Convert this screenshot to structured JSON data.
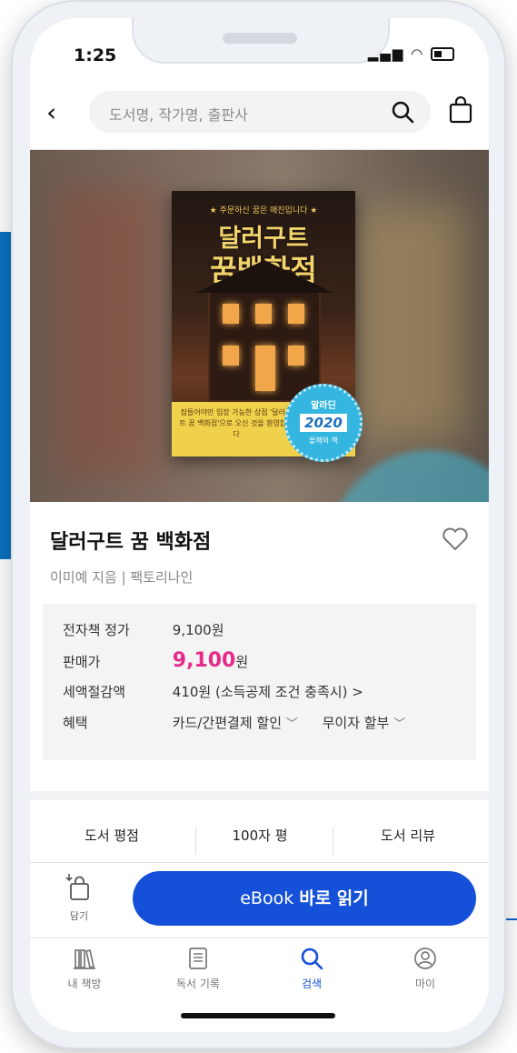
{
  "status": {
    "time": "1:25"
  },
  "search": {
    "placeholder": "도서명, 작가명, 출판사"
  },
  "cover": {
    "tagline": "★ 주문하신 꿈은 매진입니다 ★",
    "title_line1": "달러구트",
    "title_line2": "꿈백화점",
    "band_text": "잠들어야만 입장 가능한 상점\n'달러구트 꿈 백화점'으로\n오신 것을 환영합니다",
    "badge_top": "알라딘",
    "badge_year": "2020",
    "badge_bottom": "올해의 책"
  },
  "book": {
    "title": "달러구트 꿈 백화점",
    "author_line": "이미예 지음 | 팩토리나인"
  },
  "price": {
    "ebook_label": "전자책 정가",
    "ebook_value": "9,100원",
    "sale_label": "판매가",
    "sale_value": "9,100",
    "sale_unit": "원",
    "tax_label": "세액절감액",
    "tax_value": "410원 (소득공제 조건 충족시) >",
    "benefit_label": "혜택",
    "benefit_card": "카드/간편결제 할인",
    "benefit_installment": "무이자 할부"
  },
  "tabs": [
    "도서 평점",
    "100자 평",
    "도서 리뷰"
  ],
  "actions": {
    "cart_label": "담기",
    "read_prefix": "eBook ",
    "read_bold": "바로 읽기"
  },
  "nav": [
    {
      "label": "내 책방",
      "icon": "library-icon"
    },
    {
      "label": "독서 기록",
      "icon": "notes-icon"
    },
    {
      "label": "검색",
      "icon": "search-icon"
    },
    {
      "label": "마이",
      "icon": "profile-icon"
    }
  ],
  "colors": {
    "accent": "#1550d8",
    "sale_price": "#e62b8a",
    "badge": "#35b6e0"
  }
}
